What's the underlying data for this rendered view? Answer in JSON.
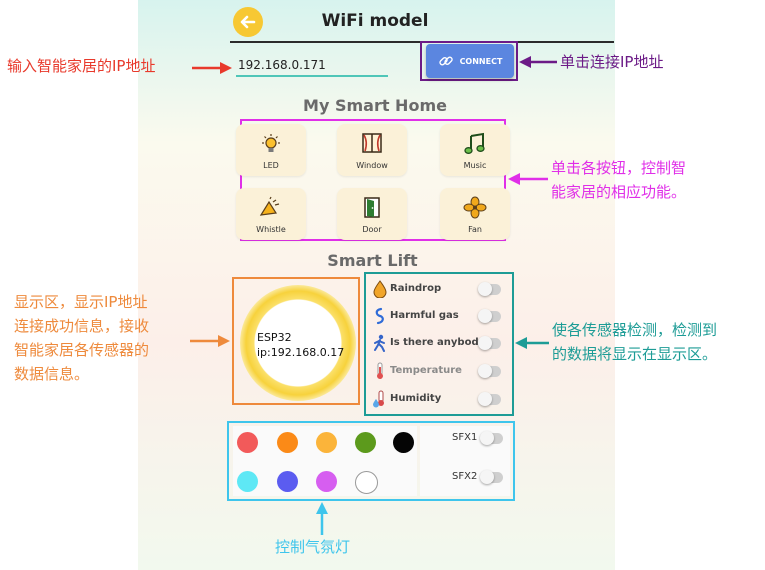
{
  "header": {
    "title": "WiFi model"
  },
  "connection": {
    "ip_value": "192.168.0.171",
    "connect_label": "CONNECT"
  },
  "smart_home": {
    "title": "My Smart Home",
    "buttons": [
      {
        "label": "LED",
        "icon": "bulb-icon"
      },
      {
        "label": "Window",
        "icon": "window-icon"
      },
      {
        "label": "Music",
        "icon": "music-note-icon"
      },
      {
        "label": "Whistle",
        "icon": "horn-icon"
      },
      {
        "label": "Door",
        "icon": "door-icon"
      },
      {
        "label": "Fan",
        "icon": "fan-icon"
      }
    ]
  },
  "smart_lift": {
    "title": "Smart Lift",
    "display_line1": "ESP32",
    "display_line2": "ip:192.168.0.17",
    "sensors": [
      {
        "label": "Raindrop",
        "icon": "raindrop-icon",
        "enabled": true
      },
      {
        "label": "Harmful gas",
        "icon": "gas-icon",
        "enabled": true
      },
      {
        "label": "Is there anybody?",
        "icon": "person-icon",
        "enabled": true
      },
      {
        "label": "Temperature",
        "icon": "thermometer-icon",
        "enabled": false
      },
      {
        "label": "Humidity",
        "icon": "humidity-icon",
        "enabled": true
      }
    ]
  },
  "ambient_light": {
    "colors": [
      "#f25a5a",
      "#fb8a17",
      "#fbb43a",
      "#5c9a1c",
      "#050505",
      "#5ee8f5",
      "#5b5cf0",
      "#d65ef0",
      "#ffffff"
    ],
    "sfx": [
      {
        "label": "SFX1"
      },
      {
        "label": "SFX2"
      }
    ]
  },
  "annotations": {
    "input_ip": "输入智能家居的IP地址",
    "click_connect": "单击连接IP地址",
    "buttons_line1": "单击各按钮，控制智",
    "buttons_line2": "能家居的相应功能。",
    "display_line1": "显示区，显示IP地址",
    "display_line2": "连接成功信息，接收",
    "display_line3": "智能家居各传感器的",
    "display_line4": "数据信息。",
    "sensors_line1": "使各传感器检测，检测到",
    "sensors_line2": "的数据将显示在显示区。",
    "ambient": "控制气氛灯"
  },
  "colors": {
    "annotation_red": "#e8392b",
    "annotation_purple": "#6c1b87",
    "annotation_magenta": "#e02fe8",
    "annotation_orange": "#ee8a3c",
    "annotation_teal": "#1d9c96",
    "annotation_cyan": "#3ec5ec"
  }
}
